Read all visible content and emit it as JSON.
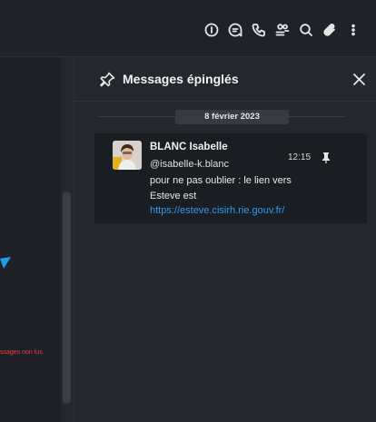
{
  "header": {
    "icons": [
      "info-icon",
      "threads-icon",
      "call-icon",
      "members-icon",
      "search-icon",
      "attachment-icon",
      "kebab-menu-icon"
    ]
  },
  "chat": {
    "unread_label": "ssages non lus"
  },
  "panel": {
    "title": "Messages épinglés",
    "date_separator": "8 février 2023",
    "message": {
      "author": "BLANC Isabelle",
      "handle": "@isabelle-k.blanc",
      "time": "12:15",
      "text_line1": "pour ne pas oublier : le lien vers",
      "text_line2": "Esteve est",
      "link": "https://esteve.cisirh.rie.gouv.fr/"
    }
  },
  "colors": {
    "background": "#1f2329",
    "panel": "#24282e",
    "message_card": "#1a1d22",
    "link": "#2f9bf0",
    "unread": "#f23d3d"
  }
}
